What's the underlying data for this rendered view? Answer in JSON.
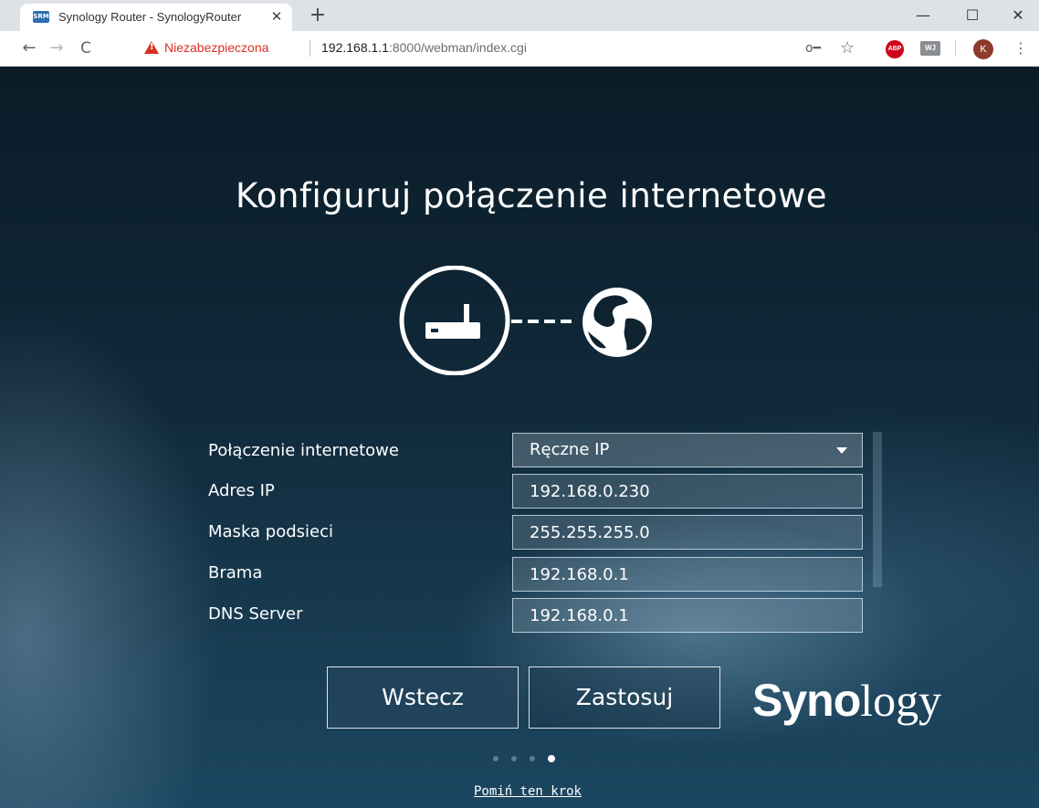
{
  "browser": {
    "tab_title": "Synology Router - SynologyRouter",
    "tab_favicon": "SRM",
    "tab_close": "✕",
    "new_tab": "+",
    "win_min": "—",
    "win_max": "☐",
    "win_close": "✕",
    "nav_back": "←",
    "nav_forward": "→",
    "nav_reload": "C",
    "security_label": "Niezabezpieczona",
    "url_host": "192.168.1.1",
    "url_rest": ":8000/webman/index.cgi",
    "key_icon": "o━",
    "star_icon": "☆",
    "abp_label": "ABP",
    "ext_label": "WJ",
    "avatar_letter": "K",
    "menu_icon": "⋮"
  },
  "page": {
    "title": "Konfiguruj połączenie internetowe",
    "form": {
      "connection_label": "Połączenie internetowe",
      "connection_value": "Ręczne IP",
      "ip_label": "Adres IP",
      "ip_value": "192.168.0.230",
      "mask_label": "Maska podsieci",
      "mask_value": "255.255.255.0",
      "gateway_label": "Brama",
      "gateway_value": "192.168.0.1",
      "dns_label": "DNS Server",
      "dns_value": "192.168.0.1"
    },
    "buttons": {
      "back": "Wstecz",
      "apply": "Zastosuj"
    },
    "logo": {
      "bold": "Syno",
      "rest": "logy"
    },
    "steps": {
      "total": 4,
      "current": 4
    },
    "skip_link": "Pomiń ten krok"
  },
  "colors": {
    "background": "#10293a",
    "text": "#ffffff",
    "insecure": "#d93025"
  },
  "icons": [
    "router-icon",
    "globe-icon",
    "warning-icon",
    "key-icon",
    "star-icon",
    "adblock-icon",
    "extension-icon",
    "menu-icon",
    "select-caret-icon"
  ]
}
